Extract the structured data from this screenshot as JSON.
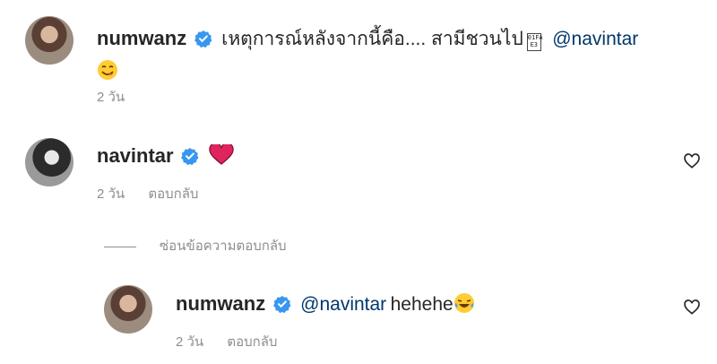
{
  "comments": [
    {
      "username": "numwanz",
      "text": "เหตุการณ์หลังจากนี้คือ.... สามีชวนไป",
      "mention": "@navintar",
      "time": "2 วัน",
      "glyph": "01FA E3"
    },
    {
      "username": "navintar",
      "time": "2 วัน",
      "reply_label": "ตอบกลับ"
    }
  ],
  "hide_replies_label": "ซ่อนข้อความตอบกลับ",
  "reply": {
    "username": "numwanz",
    "mention": "@navintar",
    "text": "hehehe",
    "time": "2 วัน",
    "reply_label": "ตอบกลับ"
  },
  "colors": {
    "mention": "#00376b",
    "verified": "#3897f0",
    "meta": "#8e8e8e",
    "heart": "#e0245e"
  }
}
